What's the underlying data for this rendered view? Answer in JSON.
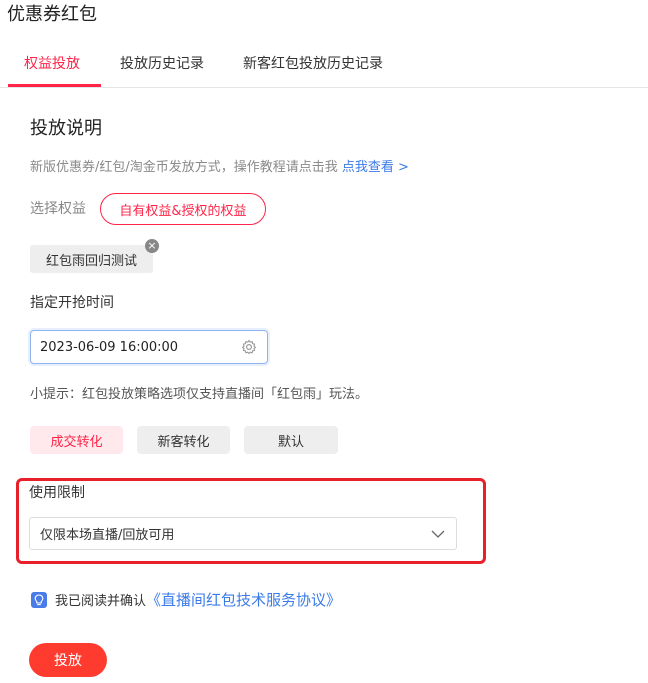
{
  "page": {
    "title": "优惠券红包"
  },
  "tabs": [
    {
      "label": "权益投放",
      "active": true
    },
    {
      "label": "投放历史记录",
      "active": false
    },
    {
      "label": "新客红包投放历史记录",
      "active": false
    }
  ],
  "section": {
    "title": "投放说明",
    "desc": "新版优惠券/红包/淘金币发放方式，操作教程请点击我",
    "desc_link": "点我查看 >"
  },
  "benefit": {
    "label": "选择权益",
    "button": "自有权益&授权的权益",
    "tag": "红包雨回归测试"
  },
  "start_time": {
    "label": "指定开抢时间",
    "value": "2023-06-09 16:00:00"
  },
  "hint": "小提示：红包投放策略选项仅支持直播间「红包雨」玩法。",
  "strategy": {
    "options": [
      {
        "label": "成交转化",
        "selected": true
      },
      {
        "label": "新客转化",
        "selected": false
      },
      {
        "label": "默认",
        "selected": false
      }
    ]
  },
  "usage": {
    "label": "使用限制",
    "selected": "仅限本场直播/回放可用"
  },
  "agreement": {
    "text": "我已阅读并确认",
    "link": "《直播间红包技术服务协议》"
  },
  "submit_label": "投放",
  "colors": {
    "accent": "#ff2448",
    "link": "#3b7be8",
    "submit": "#ff3b2f",
    "highlight": "#e8202a"
  }
}
